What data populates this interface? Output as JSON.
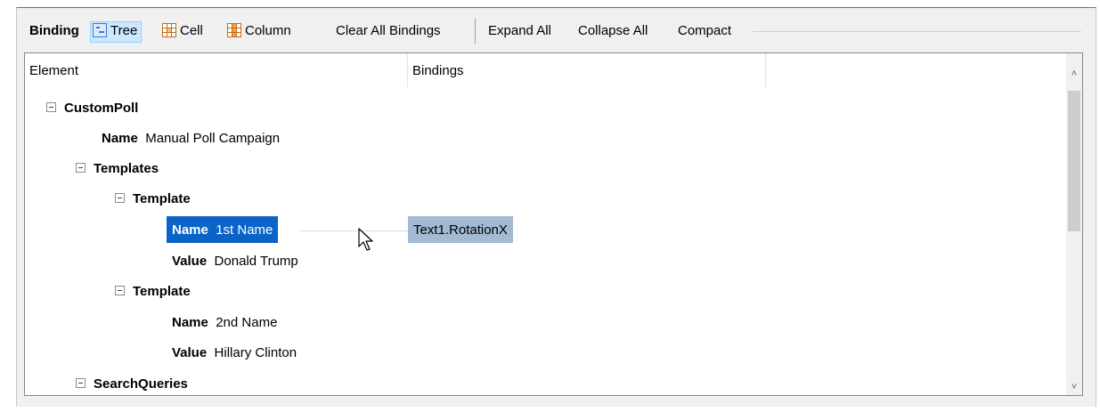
{
  "toolbar": {
    "binding_label": "Binding",
    "tree_label": "Tree",
    "cell_label": "Cell",
    "column_label": "Column",
    "clear_all_label": "Clear All Bindings",
    "expand_all_label": "Expand All",
    "collapse_all_label": "Collapse All",
    "compact_label": "Compact"
  },
  "grid": {
    "columns": [
      "Element",
      "Bindings"
    ],
    "rows": [
      {
        "type": "node",
        "label": "CustomPoll"
      },
      {
        "type": "attr",
        "key": "Name",
        "value": "Manual Poll Campaign"
      },
      {
        "type": "node",
        "label": "Templates"
      },
      {
        "type": "node",
        "label": "Template"
      },
      {
        "type": "attr",
        "key": "Name",
        "value": "1st Name",
        "selected": true,
        "binding": "Text1.RotationX"
      },
      {
        "type": "attr",
        "key": "Value",
        "value": "Donald Trump"
      },
      {
        "type": "node",
        "label": "Template"
      },
      {
        "type": "attr",
        "key": "Name",
        "value": "2nd Name"
      },
      {
        "type": "attr",
        "key": "Value",
        "value": "Hillary Clinton"
      },
      {
        "type": "node",
        "label": "SearchQueries"
      }
    ]
  },
  "icons": {
    "tree": "tree-view-icon",
    "cell": "cell-grid-icon",
    "column": "column-grid-icon",
    "expander": "collapse-minus-icon",
    "scroll_up": "chevron-up-icon",
    "scroll_down": "chevron-down-icon",
    "cursor": "mouse-pointer-icon"
  },
  "colors": {
    "selection": "#0a64c8",
    "binding_highlight": "#a3b9d4",
    "active_toggle": "#cce8ff"
  }
}
